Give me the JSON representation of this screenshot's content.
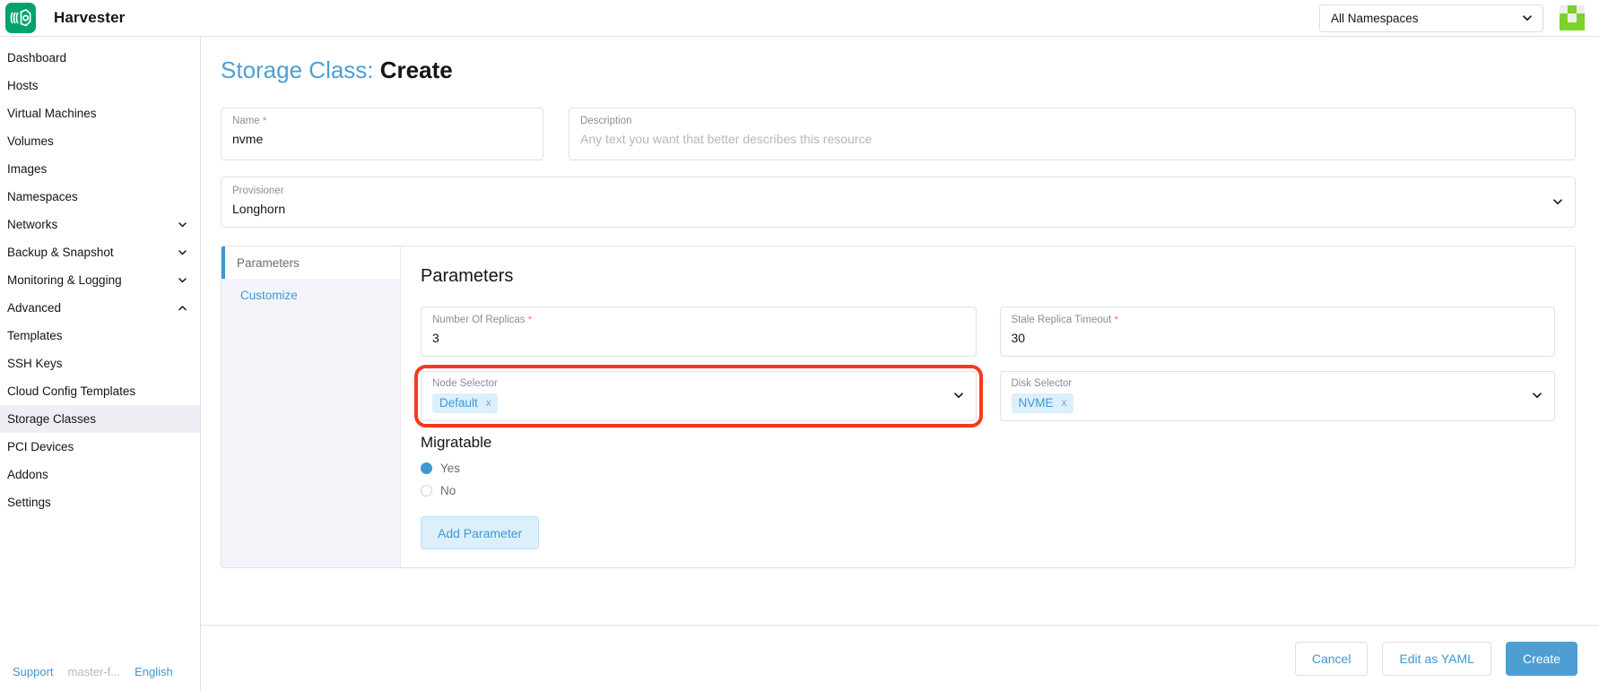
{
  "header": {
    "brand": "Harvester",
    "logo_icon": "harvester-logo-icon",
    "namespace_value": "All Namespaces",
    "namespace_caret_icon": "chevron-down-icon",
    "avatar_icon": "user-avatar-identicon"
  },
  "sidebar": {
    "items": [
      {
        "label": "Dashboard",
        "expandable": false,
        "active": false
      },
      {
        "label": "Hosts",
        "expandable": false,
        "active": false
      },
      {
        "label": "Virtual Machines",
        "expandable": false,
        "active": false
      },
      {
        "label": "Volumes",
        "expandable": false,
        "active": false
      },
      {
        "label": "Images",
        "expandable": false,
        "active": false
      },
      {
        "label": "Namespaces",
        "expandable": false,
        "active": false
      },
      {
        "label": "Networks",
        "expandable": true,
        "expanded": false,
        "active": false
      },
      {
        "label": "Backup & Snapshot",
        "expandable": true,
        "expanded": false,
        "active": false
      },
      {
        "label": "Monitoring & Logging",
        "expandable": true,
        "expanded": false,
        "active": false
      },
      {
        "label": "Advanced",
        "expandable": true,
        "expanded": true,
        "active": false
      },
      {
        "label": "Templates",
        "expandable": false,
        "active": false
      },
      {
        "label": "SSH Keys",
        "expandable": false,
        "active": false
      },
      {
        "label": "Cloud Config Templates",
        "expandable": false,
        "active": false
      },
      {
        "label": "Storage Classes",
        "expandable": false,
        "active": true
      },
      {
        "label": "PCI Devices",
        "expandable": false,
        "active": false
      },
      {
        "label": "Addons",
        "expandable": false,
        "active": false
      },
      {
        "label": "Settings",
        "expandable": false,
        "active": false
      }
    ],
    "footer": {
      "support": "Support",
      "version": "master-f...",
      "language": "English"
    }
  },
  "page": {
    "title_prefix": "Storage Class:",
    "title_suffix": "Create"
  },
  "form": {
    "name": {
      "label": "Name",
      "required_mark": "*",
      "value": "nvme"
    },
    "description": {
      "label": "Description",
      "value": "",
      "placeholder": "Any text you want that better describes this resource"
    },
    "provisioner": {
      "label": "Provisioner",
      "value": "Longhorn",
      "caret_icon": "chevron-down-icon"
    }
  },
  "card": {
    "tabs": [
      {
        "label": "Parameters",
        "active": true
      },
      {
        "label": "Customize",
        "active": false
      }
    ],
    "panel": {
      "heading": "Parameters",
      "fields": {
        "replicas": {
          "label": "Number Of Replicas",
          "required_mark": "*",
          "value": "3"
        },
        "stale_replica_timeout": {
          "label": "Stale Replica Timeout",
          "required_mark": "*",
          "value": "30"
        },
        "node_selector": {
          "label": "Node Selector",
          "chips": [
            {
              "text": "Default",
              "remove_icon": "x"
            }
          ],
          "caret_icon": "chevron-down-icon",
          "highlighted": true
        },
        "disk_selector": {
          "label": "Disk Selector",
          "chips": [
            {
              "text": "NVME",
              "remove_icon": "x"
            }
          ],
          "caret_icon": "chevron-down-icon",
          "highlighted": false
        }
      },
      "migratable": {
        "heading": "Migratable",
        "options": [
          {
            "label": "Yes",
            "selected": true
          },
          {
            "label": "No",
            "selected": false
          }
        ]
      },
      "add_parameter_label": "Add Parameter"
    }
  },
  "footer": {
    "cancel": "Cancel",
    "edit_yaml": "Edit as YAML",
    "create": "Create"
  },
  "annotation": {
    "color": "#F8381A",
    "target": "node-selector-field"
  },
  "colors": {
    "brand_green": "#00A36D",
    "link_blue": "#3D98D3",
    "primary_blue": "#4e9ed4",
    "chip_bg": "#DCF0FB",
    "required_red": "#F56C6C",
    "annotation_red": "#F8381A",
    "avatar_green": "#7CD12A"
  }
}
